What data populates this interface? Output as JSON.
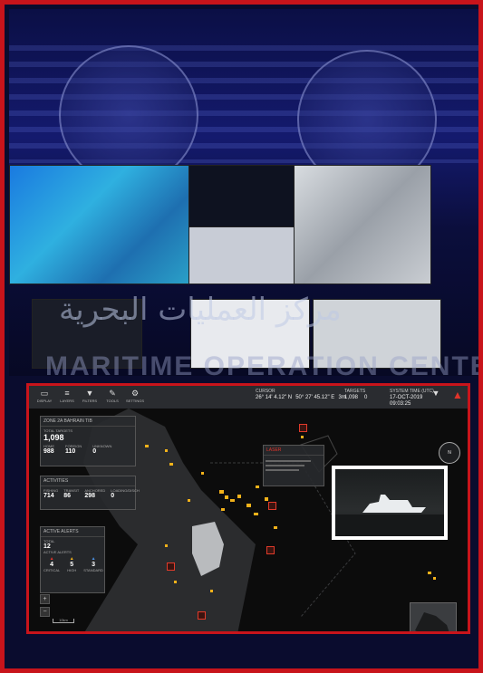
{
  "hero": {
    "arabic_title": "مركز العمليات البحرية",
    "english_title": "MARITIME OPERATION CENTER"
  },
  "toolbar": {
    "buttons": [
      {
        "label": "DISPLAY",
        "icon": "monitor-icon"
      },
      {
        "label": "LAYERS",
        "icon": "layers-icon"
      },
      {
        "label": "FILTERS",
        "icon": "filter-icon"
      },
      {
        "label": "TOOLS",
        "icon": "tools-icon"
      },
      {
        "label": "SETTINGS",
        "icon": "gear-icon"
      }
    ],
    "cursor": {
      "label": "CURSOR",
      "lat": "26° 14' 4.12\" N",
      "lon": "50° 27' 45.12\" E",
      "depth": "3m",
      "lat_sub": "LAT",
      "lon_sub": "LON",
      "depth_sub": "DEPTH"
    },
    "targets": {
      "label": "TARGETS",
      "total": "1,098",
      "total_sub": "ALL LIVE",
      "filtered": "0",
      "filtered_sub": "FILTERED"
    },
    "datetime": {
      "label": "SYSTEM TIME (UTC)",
      "date": "17-OCT-2019",
      "time": "09:03:25"
    }
  },
  "zone_card": {
    "header": "ZONE 2A BAHRAIN TIB",
    "total_label": "TOTAL TARGETS",
    "total_value": "1,098",
    "home_label": "HOME",
    "home_value": "988",
    "foreign_label": "FOREIGN",
    "foreign_value": "110",
    "unknown_label": "UNKNOWN",
    "unknown_value": "0"
  },
  "activities_card": {
    "header": "ACTIVITIES",
    "items": [
      {
        "label": "FISHING",
        "value": "714"
      },
      {
        "label": "TRANSIT",
        "value": "86"
      },
      {
        "label": "ANCHORED",
        "value": "298"
      },
      {
        "label": "LOADING/DISCH",
        "value": "0"
      }
    ]
  },
  "alerts_card": {
    "header": "ACTIVE ALERTS",
    "total_label": "TOTAL",
    "total_value": "12",
    "sub_header": "ACTIVE ALERTS",
    "items": [
      {
        "label": "CRITICAL",
        "value": "4",
        "color": "#e0342a"
      },
      {
        "label": "HIGH",
        "value": "5",
        "color": "#f2b21a"
      },
      {
        "label": "STANDARD",
        "value": "3",
        "color": "#4a8fe0"
      }
    ]
  },
  "target_popup": {
    "header": "LASER"
  },
  "map": {
    "zoom_in": "+",
    "zoom_out": "−",
    "scale": "10km",
    "compass_label": "N"
  },
  "colors": {
    "accent": "#c8141b",
    "target": "#f2b21a",
    "alert": "#e03a2a"
  }
}
